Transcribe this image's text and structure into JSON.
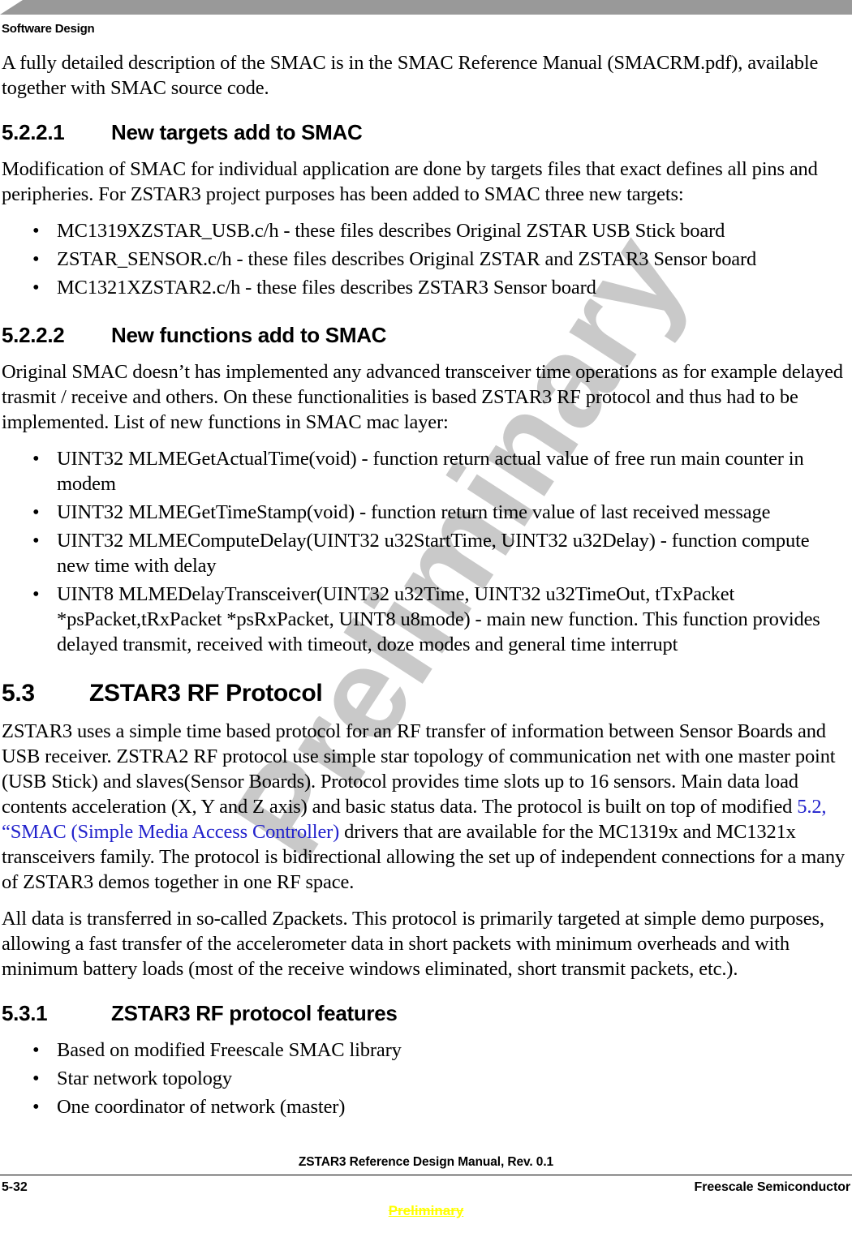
{
  "header": {
    "chapter_title": "Software Design"
  },
  "watermark": {
    "text": "Preliminary"
  },
  "body": {
    "intro_paragraph": "A fully detailed description of the SMAC is in the SMAC Reference Manual (SMACRM.pdf), available together with SMAC source code.",
    "section_5221": {
      "number": "5.2.2.1",
      "title": "New targets add to SMAC",
      "paragraph": "Modification of SMAC for individual application are done by targets files that exact defines all pins and peripheries. For ZSTAR3 project purposes has been added to SMAC three new targets:",
      "bullets": [
        "MC1319XZSTAR_USB.c/h - these files describes Original ZSTAR USB Stick board",
        "ZSTAR_SENSOR.c/h - these files describes Original ZSTAR and ZSTAR3 Sensor board",
        "MC1321XZSTAR2.c/h - these files describes ZSTAR3 Sensor board"
      ]
    },
    "section_5222": {
      "number": "5.2.2.2",
      "title": "New functions add to SMAC",
      "paragraph": "Original SMAC doesn’t has implemented any advanced transceiver time operations as for example delayed trasmit / receive and others. On these functionalities is based ZSTAR3 RF protocol and thus had to be implemented. List of new functions in SMAC mac layer:",
      "bullets": [
        "UINT32 MLMEGetActualTime(void) - function return actual value of free run main counter in modem",
        "UINT32 MLMEGetTimeStamp(void) - function return time value of last received message",
        "UINT32 MLMEComputeDelay(UINT32 u32StartTime, UINT32 u32Delay) - function compute new time with delay",
        "UINT8 MLMEDelayTransceiver(UINT32 u32Time, UINT32 u32TimeOut, tTxPacket *psPacket,tRxPacket *psRxPacket, UINT8 u8mode) - main new function. This function provides delayed transmit, received with timeout, doze modes and general time interrupt"
      ]
    },
    "section_53": {
      "number": "5.3",
      "title": "ZSTAR3 RF Protocol",
      "paragraph_1_before_link": "ZSTAR3 uses a simple time based protocol for an RF transfer of information between Sensor Boards and USB receiver. ZSTRA2 RF protocol use simple star topology of communication net with one master point (USB Stick) and slaves(Sensor Boards). Protocol provides time slots up to 16 sensors. Main data load contents acceleration (X, Y and Z axis) and basic status data. The protocol is built on top of modified ",
      "link_text": "5.2, “SMAC (Simple Media Access Controller)",
      "paragraph_1_after_link": " drivers that are available for the MC1319x and MC1321x transceivers family. The protocol is bidirectional allowing the set up of independent connections for a many of ZSTAR3 demos together in one RF space.",
      "paragraph_2": "All data is transferred in so-called Zpackets. This protocol is primarily targeted at simple demo purposes, allowing a fast transfer of the accelerometer data in short packets with minimum overheads and with minimum battery loads (most of the receive windows eliminated, short transmit packets, etc.)."
    },
    "section_531": {
      "number": "5.3.1",
      "title": "ZSTAR3 RF protocol features",
      "bullets": [
        "Based on modified Freescale SMAC library",
        "Star network topology",
        "One coordinator of network (master)"
      ]
    },
    "bullet_glyph": "•"
  },
  "footer": {
    "manual_title": "ZSTAR3 Reference Design Manual, Rev. 0.1",
    "page_number": "5-32",
    "company": "Freescale Semiconductor",
    "preliminary": "Preliminary"
  },
  "colors": {
    "header_bar": "#999999",
    "watermark": "#c9c9c9",
    "link": "#2222cc",
    "preliminary": "#ffff00"
  }
}
